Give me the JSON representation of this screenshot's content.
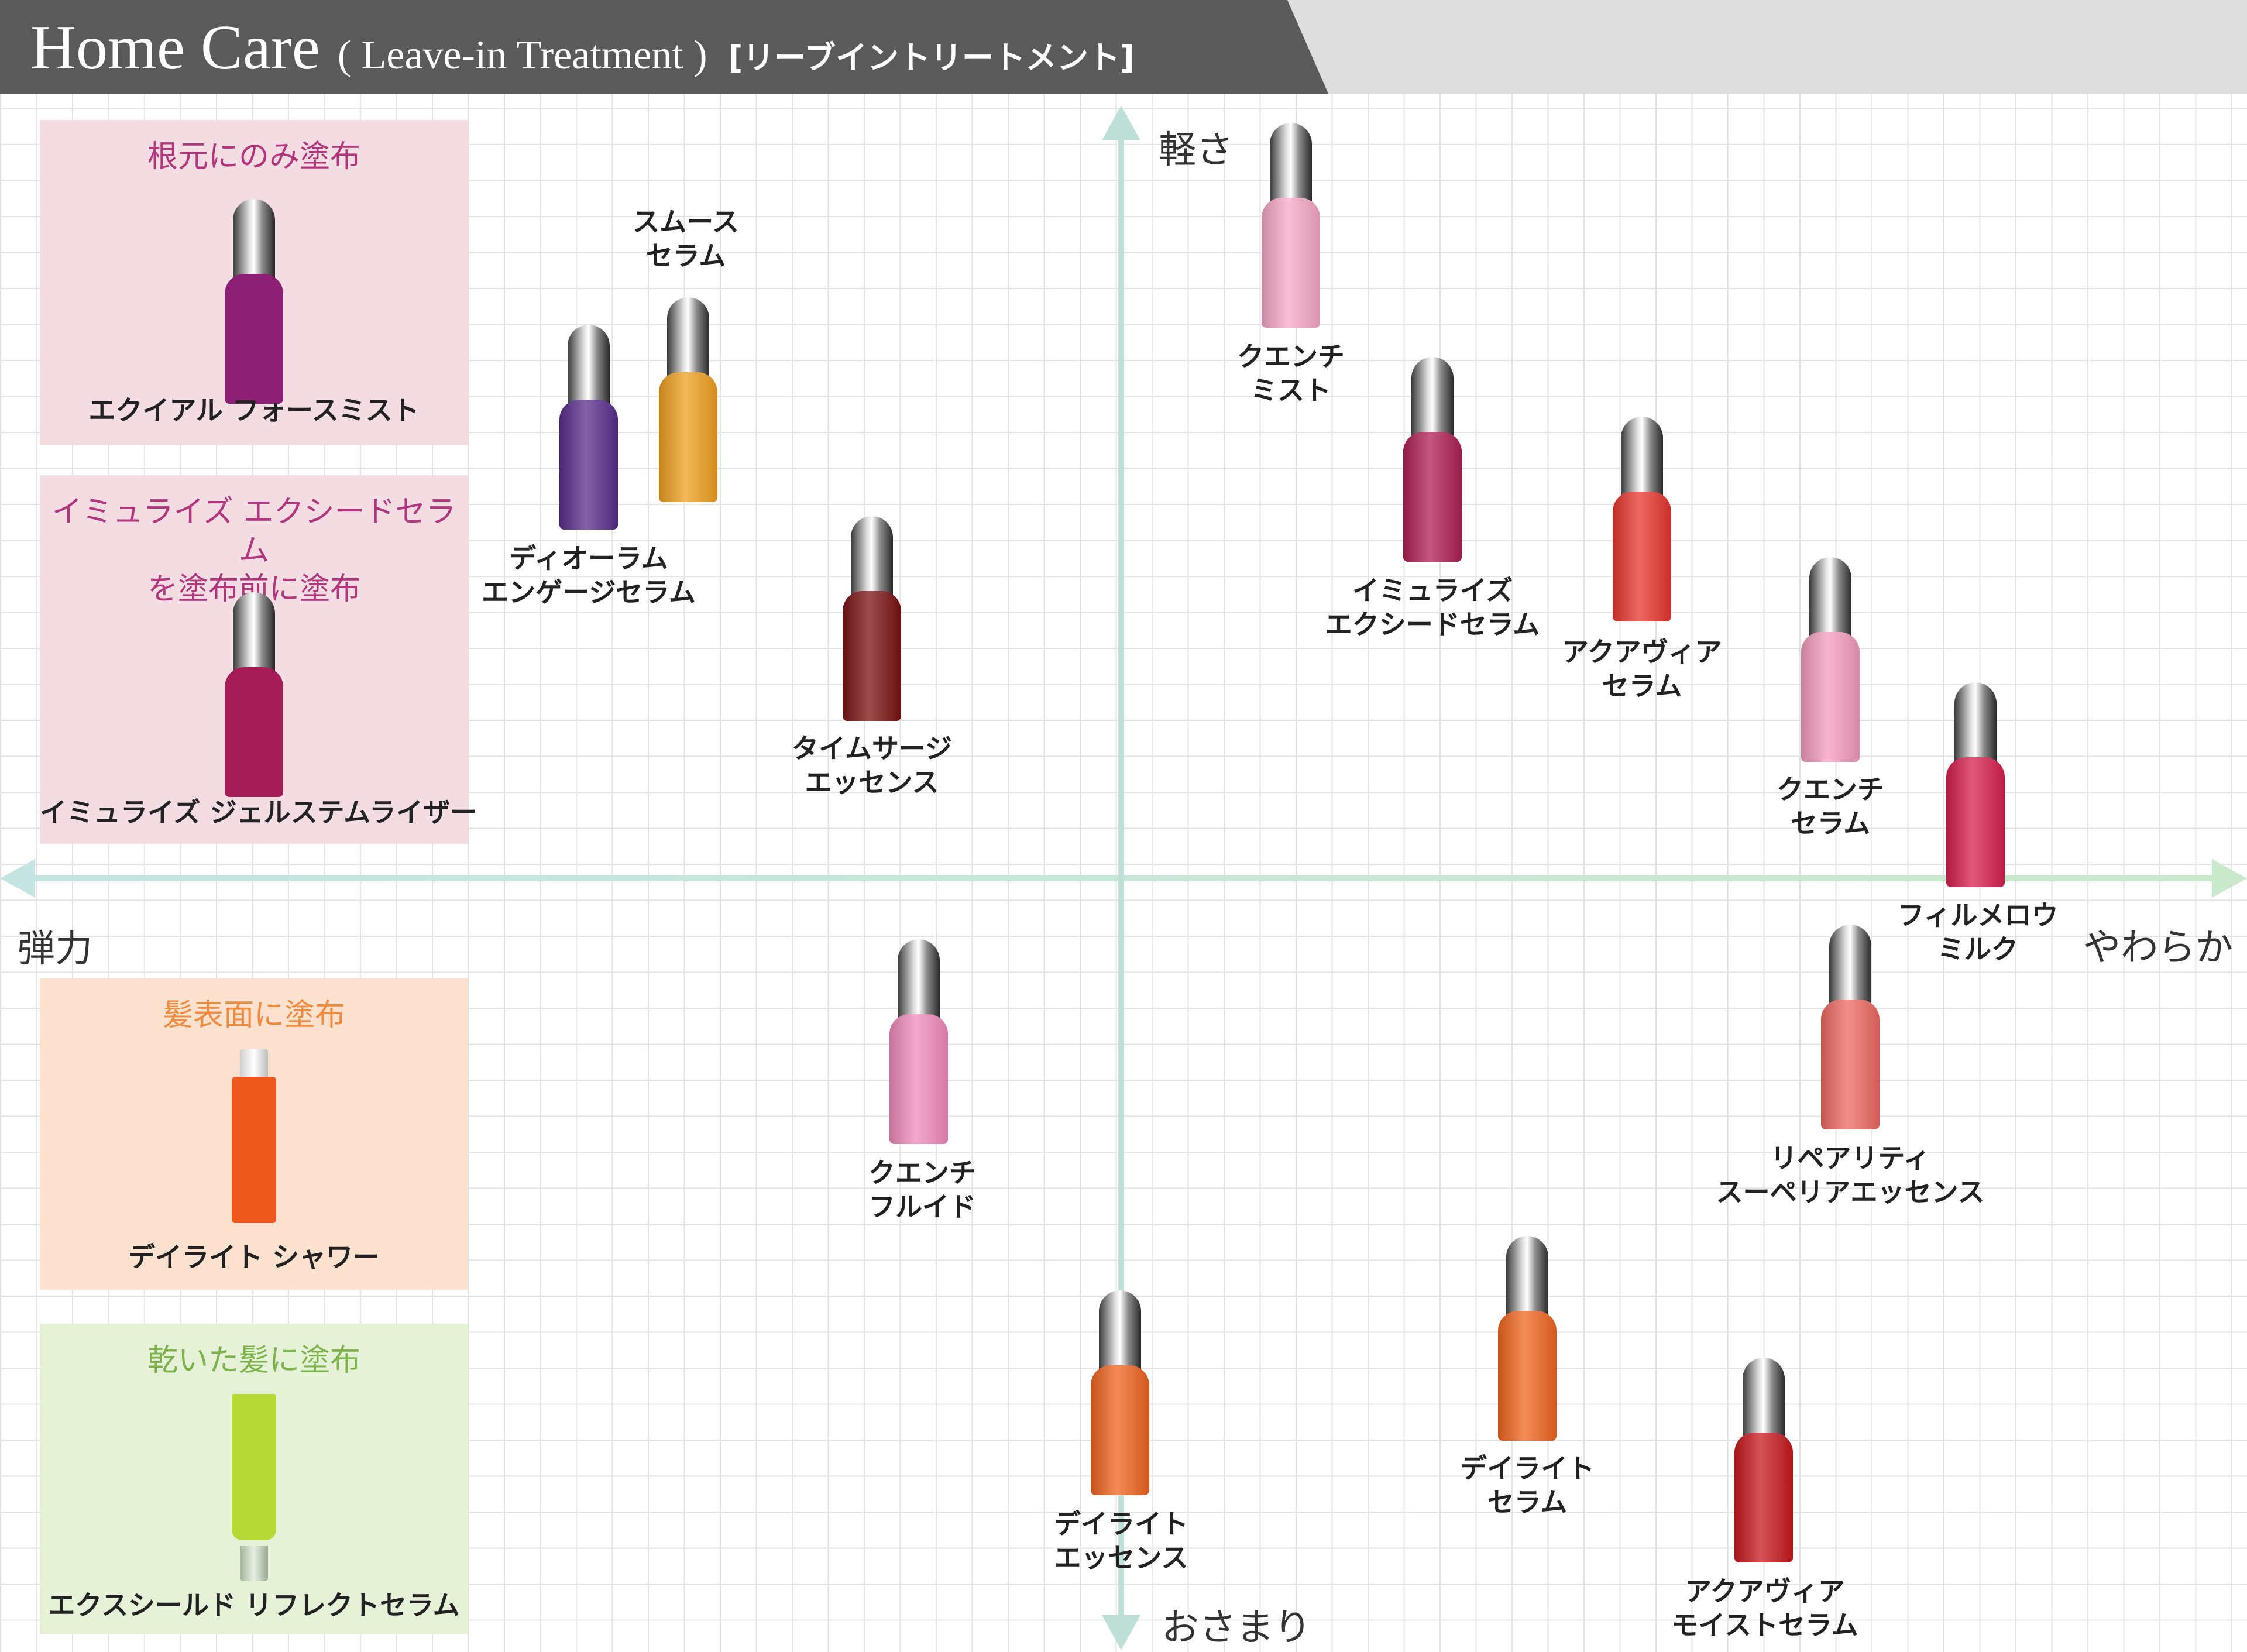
{
  "header": {
    "title": "Home Care",
    "subtitle": "( Leave-in Treatment )",
    "subtitle_jp": "[リーブイントリートメント]"
  },
  "axes": {
    "top": "軽さ",
    "bottom": "おさまり",
    "left": "弾力",
    "right": "やわらか"
  },
  "panels": [
    {
      "heading": "根元にのみ塗布",
      "product": "エクイアル フォースミスト",
      "heading_color": "#b2367c",
      "bottle_color": "#8a1f73"
    },
    {
      "heading": "イミュライズ エクシードセラム\nを塗布前に塗布",
      "product": "イミュライズ ジェルステムライザー",
      "heading_color": "#b2367c",
      "bottle_color": "#a51d54"
    },
    {
      "heading": "髪表面に塗布",
      "product": "デイライト シャワー",
      "heading_color": "#f08a3e",
      "bottle_color": "#ee5a1c"
    },
    {
      "heading": "乾いた髪に塗布",
      "product": "エクスシールド リフレクトセラム",
      "heading_color": "#7db24b",
      "bottle_color": "#b8d935"
    }
  ],
  "products": [
    {
      "name": "スムース\nセラム",
      "color": "#f0a020"
    },
    {
      "name": "ディオーラム\nエンゲージセラム",
      "color": "#5a2d8c"
    },
    {
      "name": "クエンチ\nミスト",
      "color": "#f7a8c8"
    },
    {
      "name": "イミュライズ\nエクシードセラム",
      "color": "#b01f55"
    },
    {
      "name": "アクアヴィア\nセラム",
      "color": "#e8362e"
    },
    {
      "name": "タイムサージ\nエッセンス",
      "color": "#7a1212"
    },
    {
      "name": "クエンチ\nセラム",
      "color": "#f59cbe"
    },
    {
      "name": "フィルメロウ\nミルク",
      "color": "#d81f4f"
    },
    {
      "name": "クエンチ\nフルイド",
      "color": "#f28bbb"
    },
    {
      "name": "リペアリティ\nスーペリアエッセンス",
      "color": "#ee6a62"
    },
    {
      "name": "デイライト\nセラム",
      "color": "#f1661f"
    },
    {
      "name": "デイライト\nエッセンス",
      "color": "#f06420"
    },
    {
      "name": "アクアヴィア\nモイストセラム",
      "color": "#c8191e"
    }
  ]
}
